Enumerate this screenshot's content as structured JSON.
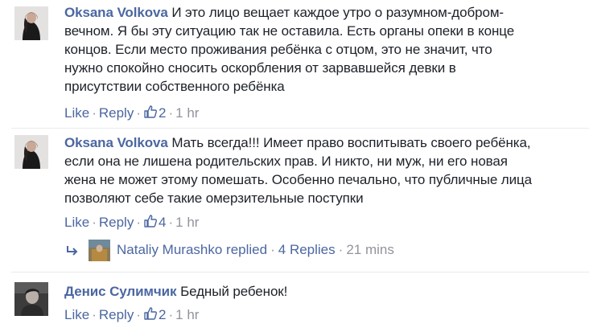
{
  "comments": [
    {
      "author": "Oksana Volkova",
      "text_lines": [
        "И это лицо вещает каждое утро о разумном-добром-",
        "вечном. Я бы эту ситуацию так не оставила. Есть органы опеки в конце",
        "концов. Если место проживания ребёнка с отцом, это не значит, что",
        "нужно спокойно сносить оскорбления от зарвавшейся девки в",
        "присутствии собственного ребёнка"
      ],
      "like_label": "Like",
      "reply_label": "Reply",
      "like_count": "2",
      "time": "1 hr"
    },
    {
      "author": "Oksana Volkova",
      "text_lines": [
        "Мать всегда!!! Имеет право воспитывать своего ребёнка,",
        "если она не лишена родительских прав. И никто, ни муж, ни его новая",
        "жена не может этому помешать. Особенно печально, что публичные лица",
        "позволяют себе такие омерзительные поступки"
      ],
      "like_label": "Like",
      "reply_label": "Reply",
      "like_count": "4",
      "time": "1 hr",
      "replies": {
        "replier": "Nataliy Murashko replied",
        "count_label": "4 Replies",
        "time": "21 mins"
      }
    },
    {
      "author": "Денис Сулимчик",
      "text_lines": [
        "Бедный ребенок!"
      ],
      "like_label": "Like",
      "reply_label": "Reply",
      "like_count": "2",
      "time": "1 hr"
    }
  ],
  "separator": "·",
  "icons": {
    "like": "thumbs-up-icon",
    "reply_arrow": "reply-arrow-icon"
  },
  "colors": {
    "link": "#4b67a1",
    "meta": "#90949c",
    "text": "#1d2129"
  }
}
